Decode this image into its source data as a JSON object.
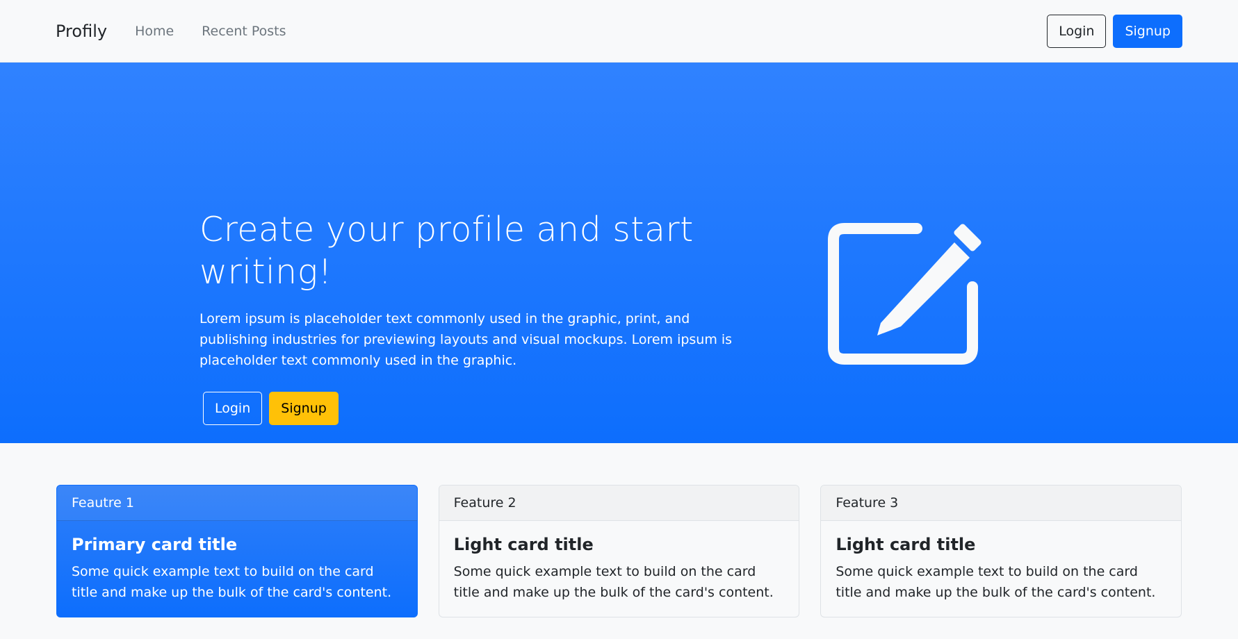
{
  "navbar": {
    "brand": "Profily",
    "links": [
      "Home",
      "Recent Posts"
    ],
    "login_label": "Login",
    "signup_label": "Signup"
  },
  "hero": {
    "title": "Create your profile and start writing!",
    "description": "Lorem ipsum is placeholder text commonly used in the graphic, print, and publishing industries for previewing layouts and visual mockups. Lorem ipsum is placeholder text commonly used in the graphic.",
    "login_label": "Login",
    "signup_label": "Signup",
    "icon": "pencil-square-icon"
  },
  "features": [
    {
      "header": "Feautre 1",
      "title": "Primary card title",
      "text": "Some quick example text to build on the card title and make up the bulk of the card's content.",
      "variant": "primary"
    },
    {
      "header": "Feature 2",
      "title": "Light card title",
      "text": "Some quick example text to build on the card title and make up the bulk of the card's content.",
      "variant": "light"
    },
    {
      "header": "Feature 3",
      "title": "Light card title",
      "text": "Some quick example text to build on the card title and make up the bulk of the card's content.",
      "variant": "light"
    }
  ],
  "colors": {
    "primary": "#0d6efd",
    "warning": "#ffc107",
    "background": "#f8f9fa"
  }
}
